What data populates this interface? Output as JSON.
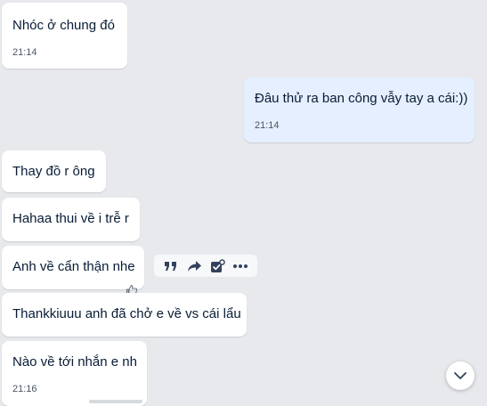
{
  "messages": [
    {
      "text": "Nhóc ở chung đó",
      "time": "21:14",
      "sender": "other"
    },
    {
      "text": "Đâu thử ra ban công vẫy tay a cái:))",
      "time": "21:14",
      "sender": "me"
    },
    {
      "text": "Thay đồ r ông",
      "sender": "other"
    },
    {
      "text": "Hahaa thui về i trễ r",
      "sender": "other"
    },
    {
      "text": "Anh về cẩn thận nhe",
      "sender": "other"
    },
    {
      "text": "Thankkiuuu anh đã chở e về vs cái lẩu",
      "sender": "other"
    },
    {
      "text": "Nào về tới nhắn e nh",
      "time": "21:16",
      "sender": "other"
    }
  ],
  "message_actions": {
    "icons": [
      "quote-icon",
      "forward-icon",
      "task-icon",
      "more-icon"
    ]
  },
  "colors": {
    "background": "#e7e9ec",
    "bubble_other": "#ffffff",
    "bubble_me": "#e5efff",
    "text": "#081c36",
    "icon": "#33415c"
  }
}
